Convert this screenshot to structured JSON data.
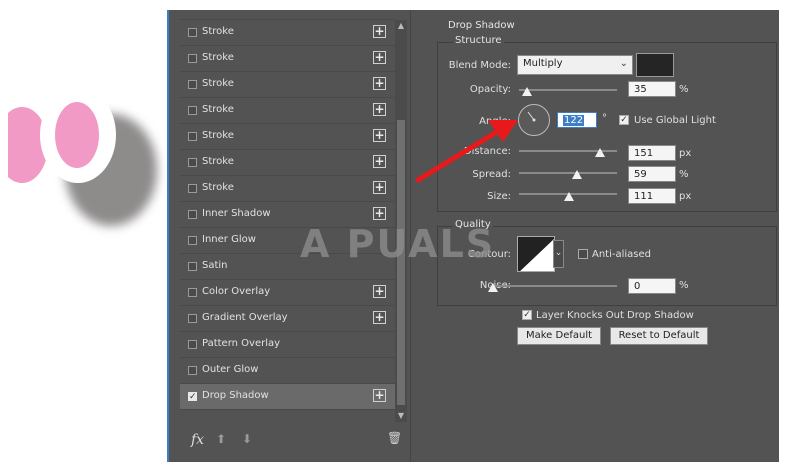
{
  "layer_styles": [
    {
      "label": "Stroke",
      "checked": false,
      "add": true
    },
    {
      "label": "Stroke",
      "checked": false,
      "add": true
    },
    {
      "label": "Stroke",
      "checked": false,
      "add": true
    },
    {
      "label": "Stroke",
      "checked": false,
      "add": true
    },
    {
      "label": "Stroke",
      "checked": false,
      "add": true
    },
    {
      "label": "Stroke",
      "checked": false,
      "add": true
    },
    {
      "label": "Stroke",
      "checked": false,
      "add": true
    },
    {
      "label": "Inner Shadow",
      "checked": false,
      "add": true
    },
    {
      "label": "Inner Glow",
      "checked": false,
      "add": false
    },
    {
      "label": "Satin",
      "checked": false,
      "add": false
    },
    {
      "label": "Color Overlay",
      "checked": false,
      "add": true
    },
    {
      "label": "Gradient Overlay",
      "checked": false,
      "add": true
    },
    {
      "label": "Pattern Overlay",
      "checked": false,
      "add": false
    },
    {
      "label": "Outer Glow",
      "checked": false,
      "add": false
    },
    {
      "label": "Drop Shadow",
      "checked": true,
      "add": true
    }
  ],
  "bottom_bar": {
    "fx": "fx",
    "up_icon": "arrow-up-icon",
    "down_icon": "arrow-down-icon",
    "trash_icon": "trash-icon"
  },
  "drop_shadow": {
    "title": "Drop Shadow",
    "structure": {
      "title": "Structure",
      "blend_mode_label": "Blend Mode:",
      "blend_mode_value": "Multiply",
      "shadow_color": "#252525",
      "opacity_label": "Opacity:",
      "opacity_value": "35",
      "opacity_unit": "%",
      "angle_label": "Angle:",
      "angle_value": "122",
      "angle_unit": "°",
      "global_light_label": "Use Global Light",
      "global_light_checked": true,
      "distance_label": "Distance:",
      "distance_value": "151",
      "distance_unit": "px",
      "spread_label": "Spread:",
      "spread_value": "59",
      "spread_unit": "%",
      "size_label": "Size:",
      "size_value": "111",
      "size_unit": "px"
    },
    "quality": {
      "title": "Quality",
      "contour_label": "Contour:",
      "anti_aliased_label": "Anti-aliased",
      "anti_aliased_checked": false,
      "noise_label": "Noise:",
      "noise_value": "0",
      "noise_unit": "%"
    },
    "knockout_label": "Layer Knocks Out Drop Shadow",
    "knockout_checked": true,
    "make_default_label": "Make Default",
    "reset_default_label": "Reset to Default"
  },
  "watermark": "A PUALS",
  "colors": {
    "panel": "#535353",
    "accent": "#3d7fc6",
    "arrow": "#e8191a",
    "pink": "#f19ac6"
  }
}
